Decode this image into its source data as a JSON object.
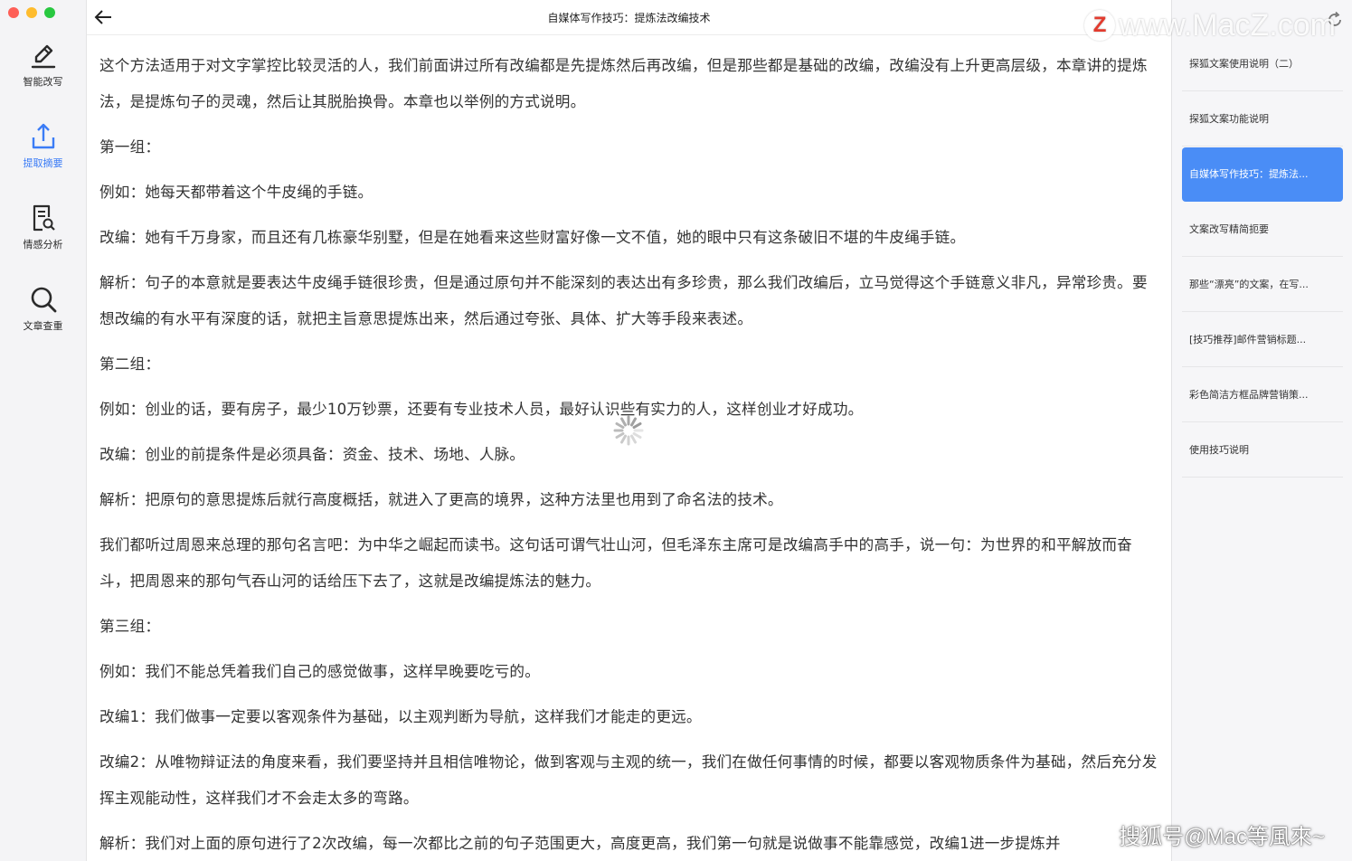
{
  "window": {
    "title": "自媒体写作技巧：提炼法改编技术"
  },
  "rail": {
    "items": [
      {
        "label": "智能改写",
        "icon": "edit-pen-icon",
        "active": false
      },
      {
        "label": "提取摘要",
        "icon": "upload-tray-icon",
        "active": true
      },
      {
        "label": "情感分析",
        "icon": "document-search-icon",
        "active": false
      },
      {
        "label": "文章查重",
        "icon": "search-icon",
        "active": false
      }
    ]
  },
  "article": {
    "paragraphs": [
      "这个方法适用于对文字掌控比较灵活的人，我们前面讲过所有改编都是先提炼然后再改编，但是那些都是基础的改编，改编没有上升更高层级，本章讲的提炼法，是提炼句子的灵魂，然后让其脱胎换骨。本章也以举例的方式说明。",
      "第一组：",
      "例如：她每天都带着这个牛皮绳的手链。",
      "改编：她有千万身家，而且还有几栋豪华别墅，但是在她看来这些财富好像一文不值，她的眼中只有这条破旧不堪的牛皮绳手链。",
      "解析：句子的本意就是要表达牛皮绳手链很珍贵，但是通过原句并不能深刻的表达出有多珍贵，那么我们改编后，立马觉得这个手链意义非凡，异常珍贵。要想改编的有水平有深度的话，就把主旨意思提炼出来，然后通过夸张、具体、扩大等手段来表述。",
      "第二组：",
      "例如：创业的话，要有房子，最少10万钞票，还要有专业技术人员，最好认识些有实力的人，这样创业才好成功。",
      "改编：创业的前提条件是必须具备：资金、技术、场地、人脉。",
      "解析：把原句的意思提炼后就行高度概括，就进入了更高的境界，这种方法里也用到了命名法的技术。",
      "我们都听过周恩来总理的那句名言吧：为中华之崛起而读书。这句话可谓气壮山河，但毛泽东主席可是改编高手中的高手，说一句：为世界的和平解放而奋斗，把周恩来的那句气吞山河的话给压下去了，这就是改编提炼法的魅力。",
      "第三组：",
      "例如：我们不能总凭着我们自己的感觉做事，这样早晚要吃亏的。",
      "改编1：我们做事一定要以客观条件为基础，以主观判断为导航，这样我们才能走的更远。",
      "改编2：从唯物辩证法的角度来看，我们要坚持并且相信唯物论，做到客观与主观的统一，我们在做任何事情的时候，都要以客观物质条件为基础，然后充分发挥主观能动性，这样我们才不会走太多的弯路。",
      "解析：我们对上面的原句进行了2次改编，每一次都比之前的句子范围更大，高度更高，我们第一句就是说做事不能靠感觉，改编1进一步提炼并"
    ]
  },
  "sidebar": {
    "items": [
      {
        "label": "探狐文案使用说明（二）",
        "active": false
      },
      {
        "label": "探狐文案功能说明",
        "active": false
      },
      {
        "label": "自媒体写作技巧：提炼法...",
        "active": true
      },
      {
        "label": "文案改写精简扼要",
        "active": false
      },
      {
        "label": "那些“漂亮”的文案，在写...",
        "active": false
      },
      {
        "label": "[技巧推荐]邮件营销标题...",
        "active": false
      },
      {
        "label": "彩色简洁方框品牌营销策...",
        "active": false
      },
      {
        "label": "使用技巧说明",
        "active": false
      }
    ]
  },
  "watermarks": {
    "top": "www.MacZ.com",
    "top_logo": "Z",
    "bottom": "搜狐号@Mac等風來~"
  },
  "colors": {
    "accent": "#4a8df6",
    "rail_active": "#3b7cf6"
  }
}
